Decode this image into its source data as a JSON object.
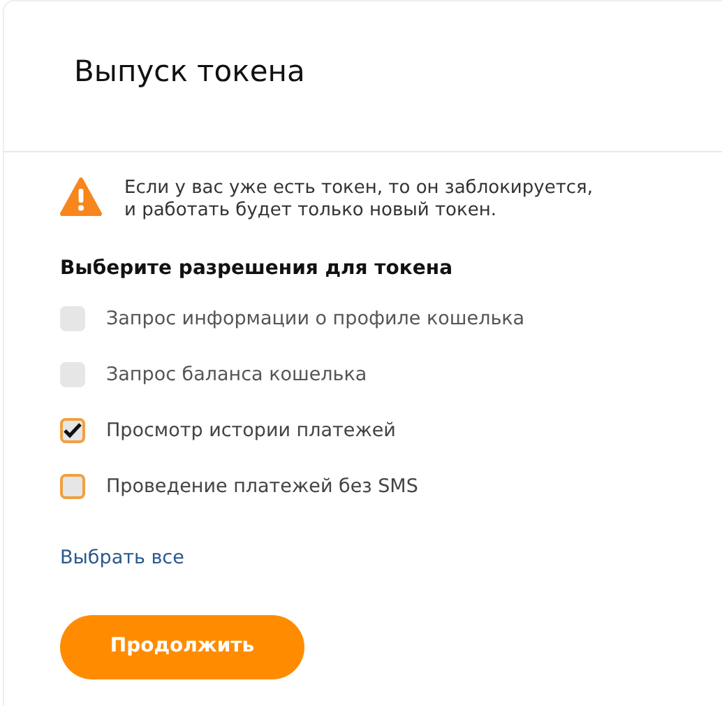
{
  "dialog": {
    "title": "Выпуск токена"
  },
  "warning": {
    "text": "Если у вас уже есть токен, то он заблокируется,\nи работать будет только новый токен."
  },
  "permissions": {
    "heading": "Выберите разрешения для токена",
    "items": [
      {
        "label": "Запрос информации о профиле кошелька",
        "checked": false,
        "disabled": true
      },
      {
        "label": "Запрос баланса кошелька",
        "checked": false,
        "disabled": true
      },
      {
        "label": "Просмотр истории платежей",
        "checked": true,
        "disabled": false
      },
      {
        "label": "Проведение платежей без SMS",
        "checked": false,
        "disabled": false
      }
    ]
  },
  "select_all": "Выбрать все",
  "continue_button": "Продолжить"
}
